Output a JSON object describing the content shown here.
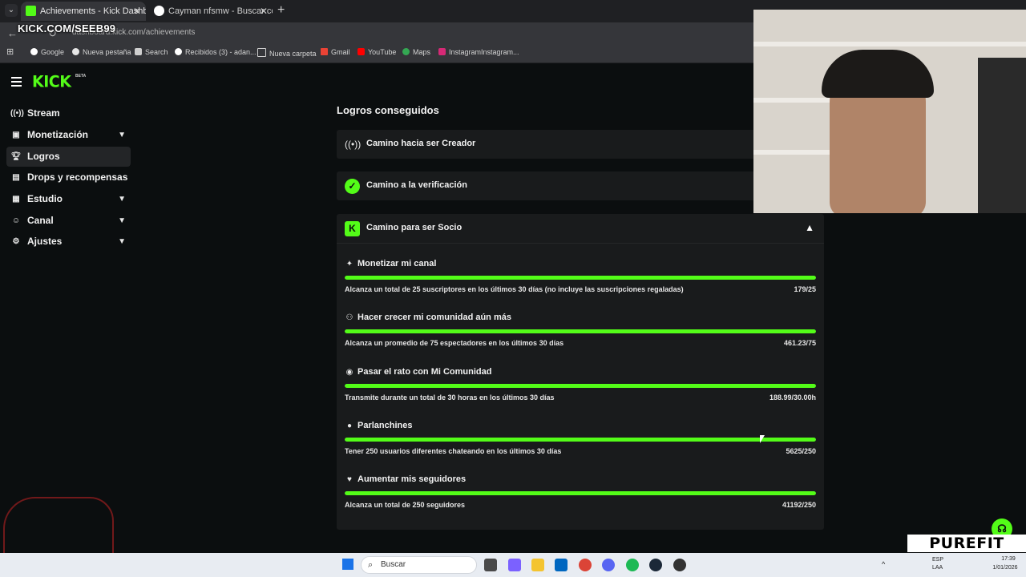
{
  "browser": {
    "tabs": [
      {
        "label": "Achievements - Kick Dashboard",
        "active": true
      },
      {
        "label": "Cayman nfsmw - Buscar con Go",
        "active": false
      }
    ],
    "url": "dashboard.kick.com/achievements",
    "overlay_handle": "KICK.COM/SEEB99",
    "bookmarks": [
      "Google",
      "Nueva pestaña",
      "Search",
      "Recibidos (3) - adan...",
      "Nueva carpeta",
      "Gmail",
      "YouTube",
      "Maps",
      "InstagramInstagram..."
    ]
  },
  "sidebar": {
    "logo": "KICK",
    "logo_badge": "BETA",
    "items": [
      {
        "label": "Stream",
        "icon": "broadcast-icon",
        "expandable": false
      },
      {
        "label": "Monetización",
        "icon": "dollar-icon",
        "expandable": true
      },
      {
        "label": "Logros",
        "icon": "trophy-icon",
        "expandable": false,
        "active": true
      },
      {
        "label": "Drops y recompensas",
        "icon": "gift-icon",
        "expandable": false
      },
      {
        "label": "Estudio",
        "icon": "layers-icon",
        "expandable": true
      },
      {
        "label": "Canal",
        "icon": "users-icon",
        "expandable": true
      },
      {
        "label": "Ajustes",
        "icon": "gear-icon",
        "expandable": true
      }
    ]
  },
  "main": {
    "section_title": "Logros conseguidos",
    "cards": [
      {
        "label": "Camino hacia ser Creador",
        "icon": "broadcast-icon"
      },
      {
        "label": "Camino a la verificación",
        "icon": "verified-badge-icon"
      },
      {
        "label": "Camino para ser Socio",
        "icon": "kick-logo-icon",
        "expanded": true
      }
    ],
    "goals": [
      {
        "title": "Monetizar mi canal",
        "icon": "sparkle-icon",
        "description": "Alcanza un total de 25 suscriptores en los últimos 30 días (no incluye las suscripciones regaladas)",
        "value": "179/25",
        "progress": 1.0
      },
      {
        "title": "Hacer crecer mi comunidad aún más",
        "icon": "community-icon",
        "description": "Alcanza un promedio de 75 espectadores en los últimos 30 días",
        "value": "461.23/75",
        "progress": 1.0
      },
      {
        "title": "Pasar el rato con Mi Comunidad",
        "icon": "broadcast-icon",
        "description": "Transmite durante un total de 30 horas en los últimos 30 días",
        "value": "188.99/30.00h",
        "progress": 1.0
      },
      {
        "title": "Parlanchines",
        "icon": "chat-icon",
        "description": "Tener 250 usuarios diferentes chateando en los últimos 30 días",
        "value": "5625/250",
        "progress": 1.0
      },
      {
        "title": "Aumentar mis seguidores",
        "icon": "heart-icon",
        "description": "Alcanza un total de 250 seguidores",
        "value": "41192/250",
        "progress": 1.0
      }
    ]
  },
  "overlay": {
    "sponsor": "PUREFIT"
  },
  "taskbar": {
    "search_placeholder": "Buscar",
    "lang_top": "ESP",
    "lang_bottom": "LAA",
    "time": "17:39",
    "date": "1/01/2026"
  },
  "colors": {
    "accent": "#53fc18",
    "background": "#0b0e0f",
    "card": "#191b1c"
  }
}
